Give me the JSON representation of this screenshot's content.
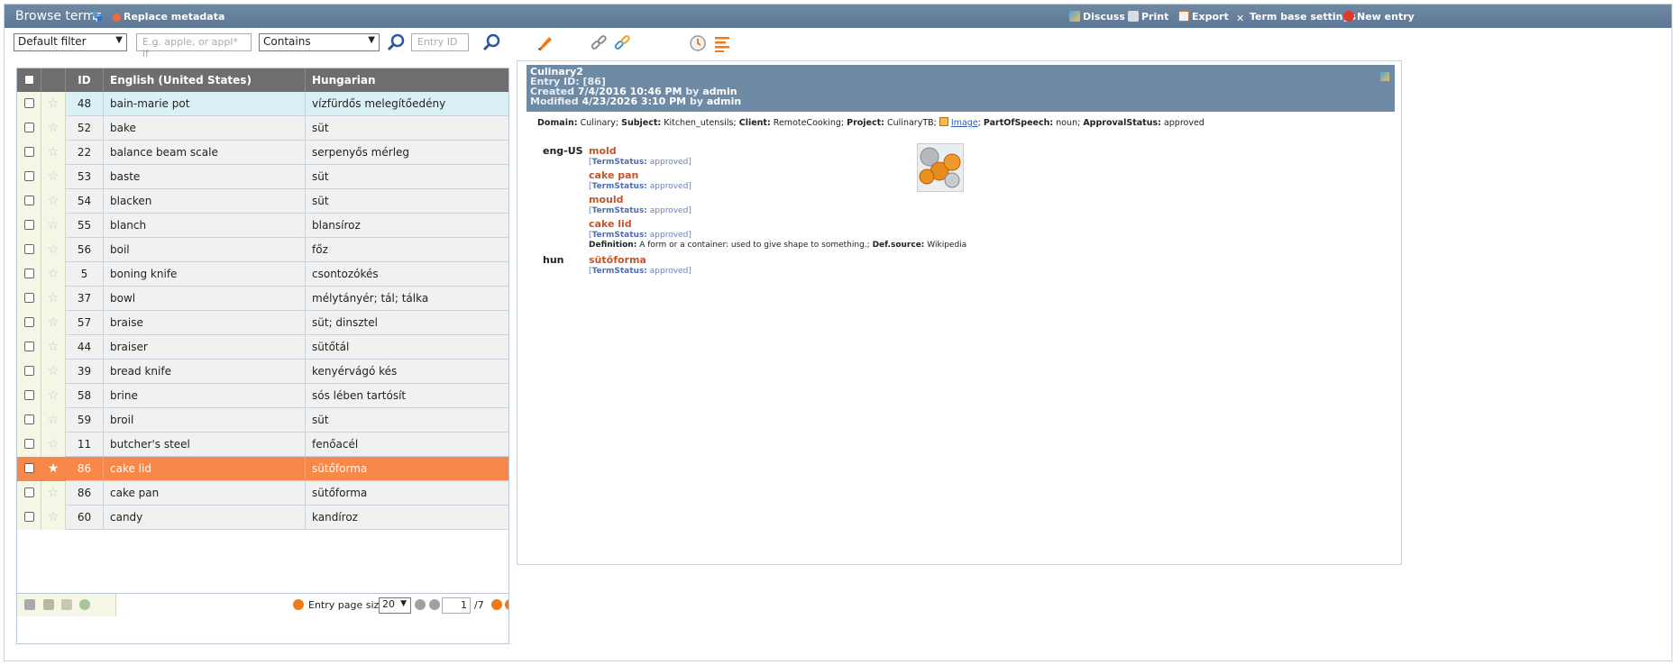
{
  "header": {
    "title": "Browse terms",
    "replace_label": "Replace metadata",
    "discuss": "Discuss",
    "print": "Print",
    "export": "Export",
    "settings": "Term base settings",
    "new_entry": "New entry"
  },
  "toolbar": {
    "filter_value": "Default filter",
    "search_placeholder": "E.g. apple, or appl* if",
    "match_value": "Contains",
    "entry_id_placeholder": "Entry ID"
  },
  "grid": {
    "headers": {
      "id": "ID",
      "source": "English (United States)",
      "target": "Hungarian"
    },
    "rows": [
      {
        "id": "48",
        "en": "bain-marie pot",
        "hu": "vízfürdős melegítőedény"
      },
      {
        "id": "52",
        "en": "bake",
        "hu": "süt"
      },
      {
        "id": "22",
        "en": "balance beam scale",
        "hu": "serpenyős mérleg"
      },
      {
        "id": "53",
        "en": "baste",
        "hu": "süt"
      },
      {
        "id": "54",
        "en": "blacken",
        "hu": "süt"
      },
      {
        "id": "55",
        "en": "blanch",
        "hu": "blansíroz"
      },
      {
        "id": "56",
        "en": "boil",
        "hu": "főz"
      },
      {
        "id": "5",
        "en": "boning knife",
        "hu": "csontozókés"
      },
      {
        "id": "37",
        "en": "bowl",
        "hu": "mélytányér; tál; tálka"
      },
      {
        "id": "57",
        "en": "braise",
        "hu": "süt; dinsztel"
      },
      {
        "id": "44",
        "en": "braiser",
        "hu": "sütőtál"
      },
      {
        "id": "39",
        "en": "bread knife",
        "hu": "kenyérvágó kés"
      },
      {
        "id": "58",
        "en": "brine",
        "hu": "sós lében tartósít"
      },
      {
        "id": "59",
        "en": "broil",
        "hu": "süt"
      },
      {
        "id": "11",
        "en": "butcher's steel",
        "hu": "fenőacél"
      },
      {
        "id": "86",
        "en": "cake lid",
        "hu": "sütőforma"
      },
      {
        "id": "86",
        "en": "cake pan",
        "hu": "sütőforma"
      },
      {
        "id": "60",
        "en": "candy",
        "hu": "kandíroz"
      }
    ],
    "selected_index": 15,
    "footer": {
      "page_size_label": "Entry page size:",
      "page_size": "20",
      "page": "1",
      "total": "/7"
    }
  },
  "entry": {
    "name": "Culinary2",
    "id_label": "Entry ID: [86]",
    "created_label": "Created",
    "created": "7/4/2016 10:46 PM",
    "modified_label": "Modified",
    "modified": "4/23/2026 3:10 PM",
    "by": "by",
    "user": "admin",
    "meta": {
      "domain_label": "Domain:",
      "domain": "Culinary;",
      "subject_label": "Subject:",
      "subject": "Kitchen_utensils;",
      "client_label": "Client:",
      "client": "RemoteCooking;",
      "project_label": "Project:",
      "project": "CulinaryTB;",
      "image_link": "Image",
      "pos_label": "PartOfSpeech:",
      "pos": "noun;",
      "approval_label": "ApprovalStatus:",
      "approval": "approved"
    },
    "languages": [
      {
        "code": "eng-US",
        "terms": [
          {
            "term": "mold",
            "status_label": "TermStatus:",
            "status": "approved"
          },
          {
            "term": "cake pan",
            "status_label": "TermStatus:",
            "status": "approved"
          },
          {
            "term": "mould",
            "status_label": "TermStatus:",
            "status": "approved"
          },
          {
            "term": "cake lid",
            "status_label": "TermStatus:",
            "status": "approved"
          }
        ],
        "definition_label": "Definition:",
        "definition": "A form or a container: used to give shape to something.;",
        "def_source_label": "Def.source:",
        "def_source": "Wikipedia"
      },
      {
        "code": "hun",
        "terms": [
          {
            "term": "sütőforma",
            "status_label": "TermStatus:",
            "status": "approved"
          }
        ]
      }
    ]
  },
  "colors": {
    "header_bg": "#5d7794",
    "selected_row": "#f8884a",
    "term": "#c0552a",
    "accent_orange": "#f07a1a"
  }
}
